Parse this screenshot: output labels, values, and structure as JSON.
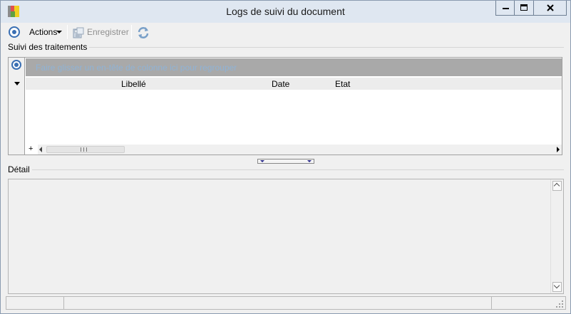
{
  "window": {
    "title": "Logs de suivi du document",
    "icon": "app-icon",
    "controls": [
      "minimize-icon",
      "maximize-icon",
      "close-icon"
    ]
  },
  "toolbar": {
    "nav_icon": "circle-target-icon",
    "actions_label": "Actions",
    "save_label": "Enregistrer",
    "save_icon": "save-icon",
    "refresh_icon": "refresh-icon"
  },
  "tracking": {
    "group_title": "Suivi des traitements",
    "group_band_hint": "Faire glisser un en-tête de colonne ici pour regrouper",
    "columns": [
      "Libellé",
      "Date",
      "Etat"
    ],
    "rows": []
  },
  "detail": {
    "group_title": "Détail",
    "text": ""
  },
  "status": {
    "panels": [
      "",
      "",
      ""
    ]
  },
  "colors": {
    "accent": "#3a6fb3",
    "group_band": "#a9a9a9",
    "title_bar": "#dfe7f1"
  }
}
